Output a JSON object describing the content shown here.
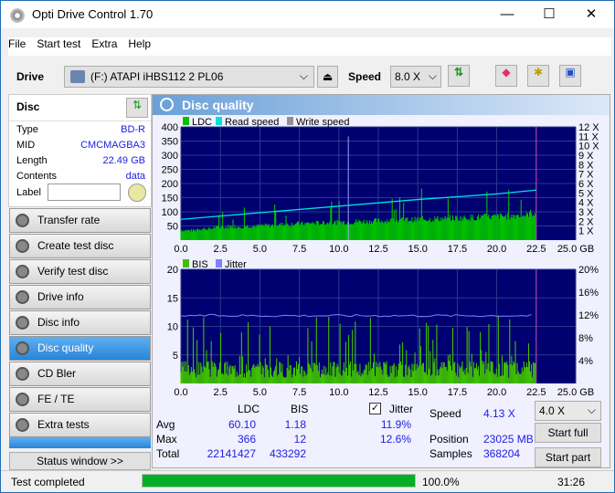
{
  "window": {
    "title": "Opti Drive Control 1.70",
    "minimize": "—",
    "maximize": "☐",
    "close": "✕"
  },
  "menu": [
    "File",
    "Start test",
    "Extra",
    "Help"
  ],
  "toolbar": {
    "drive_label": "Drive",
    "drive_value": "(F:)   ATAPI iHBS112   2 PL06",
    "speed_label": "Speed",
    "speed_value": "8.0 X"
  },
  "disc": {
    "header": "Disc",
    "rows": [
      {
        "k": "Type",
        "v": "BD-R"
      },
      {
        "k": "MID",
        "v": "CMCMAGBA3"
      },
      {
        "k": "Length",
        "v": "22.49 GB"
      },
      {
        "k": "Contents",
        "v": "data"
      }
    ],
    "label_label": "Label",
    "label_value": ""
  },
  "nav": [
    {
      "label": "Transfer rate"
    },
    {
      "label": "Create test disc"
    },
    {
      "label": "Verify test disc"
    },
    {
      "label": "Drive info"
    },
    {
      "label": "Disc info"
    },
    {
      "label": "Disc quality",
      "active": true
    },
    {
      "label": "CD Bler"
    },
    {
      "label": "FE / TE"
    },
    {
      "label": "Extra tests"
    }
  ],
  "status_window": "Status window >>",
  "panel_title": "Disc quality",
  "colors": {
    "ldc": "#00c000",
    "read": "#00e0e0",
    "write": "#909090",
    "bis": "#40c000",
    "jitter": "#8080ff",
    "plot_bg": "#000070",
    "progress": "#06b025"
  },
  "chart_data": [
    {
      "type": "bar",
      "legend": [
        "LDC",
        "Read speed",
        "Write speed"
      ],
      "x_ticks": [
        "0.0",
        "2.5",
        "5.0",
        "7.5",
        "10.0",
        "12.5",
        "15.0",
        "17.5",
        "20.0",
        "22.5",
        "25.0 GB"
      ],
      "xlim": [
        0,
        25
      ],
      "ylim": [
        0,
        400
      ],
      "y_ticks": [
        "400",
        "350",
        "300",
        "250",
        "200",
        "150",
        "100",
        "50"
      ],
      "y2_ticks": [
        "12 X",
        "11 X",
        "10 X",
        "9 X",
        "8 X",
        "7 X",
        "6 X",
        "5 X",
        "4 X",
        "3 X",
        "2 X",
        "1 X"
      ],
      "y2lim": [
        0,
        12
      ],
      "ldc_x": [
        0.5,
        1.5,
        2.5,
        3.5,
        4.5,
        5.5,
        6.5,
        7.5,
        8.5,
        9.5,
        10.5,
        11.5,
        12.5,
        13.5,
        14.5,
        15.5,
        16.5,
        17.5,
        18.5,
        19.5,
        20.5,
        21.5,
        22.3
      ],
      "ldc": [
        35,
        40,
        45,
        48,
        50,
        52,
        55,
        58,
        60,
        62,
        64,
        66,
        68,
        70,
        72,
        74,
        76,
        78,
        80,
        82,
        84,
        88,
        95
      ],
      "ldc_max": 366,
      "ldc_max_x": 10.6,
      "read_speed": [
        [
          0,
          2.2
        ],
        [
          5,
          2.9
        ],
        [
          10,
          3.6
        ],
        [
          15,
          4.3
        ],
        [
          20,
          4.9
        ],
        [
          22.5,
          5.3
        ]
      ]
    },
    {
      "type": "bar",
      "legend": [
        "BIS",
        "Jitter"
      ],
      "x_ticks": [
        "0.0",
        "2.5",
        "5.0",
        "7.5",
        "10.0",
        "12.5",
        "15.0",
        "17.5",
        "20.0",
        "22.5",
        "25.0 GB"
      ],
      "xlim": [
        0,
        25
      ],
      "ylim": [
        0,
        20
      ],
      "y_ticks": [
        "20",
        "15",
        "10",
        "5"
      ],
      "y2_ticks": [
        "20%",
        "16%",
        "12%",
        "8%",
        "4%"
      ],
      "y2lim": [
        0,
        20
      ],
      "bis_typical": 2,
      "bis_max": 12,
      "jitter_avg": 11.9
    }
  ],
  "stats": {
    "col_ldc": "LDC",
    "col_bis": "BIS",
    "jitter_label": "Jitter",
    "jitter_checked": true,
    "rows": [
      {
        "k": "Avg",
        "ldc": "60.10",
        "bis": "1.18",
        "jit": "11.9%"
      },
      {
        "k": "Max",
        "ldc": "366",
        "bis": "12",
        "jit": "12.6%"
      },
      {
        "k": "Total",
        "ldc": "22141427",
        "bis": "433292",
        "jit": ""
      }
    ],
    "speed_label": "Speed",
    "speed_value": "4.13 X",
    "position_label": "Position",
    "position_value": "23025 MB",
    "samples_label": "Samples",
    "samples_value": "368204",
    "speed_select": "4.0 X",
    "start_full": "Start full",
    "start_part": "Start part"
  },
  "status": {
    "text": "Test completed",
    "progress": 100.0,
    "progress_text": "100.0%",
    "time": "31:26"
  }
}
